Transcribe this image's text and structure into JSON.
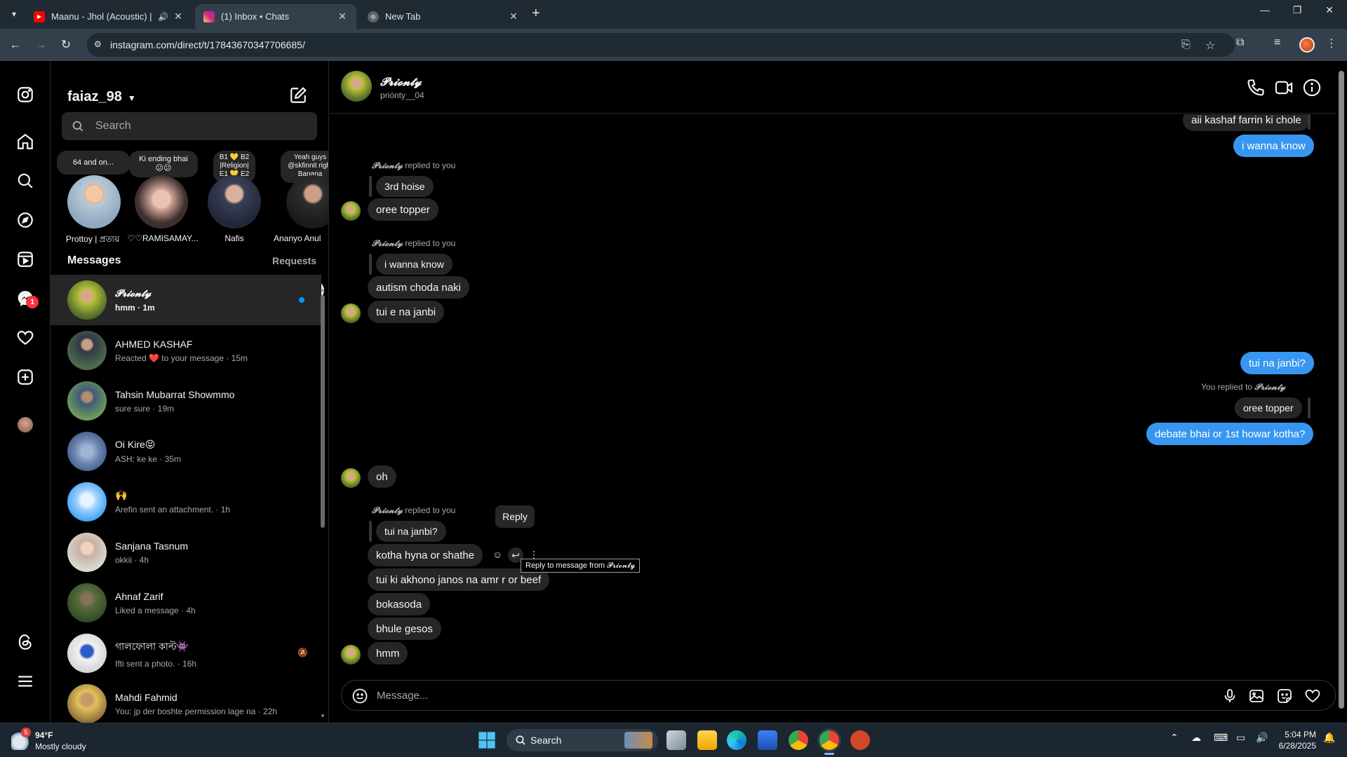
{
  "browser": {
    "tabs": [
      {
        "title": "Maanu - Jhol (Acoustic) | An",
        "favicon": "youtube-icon",
        "audio": true
      },
      {
        "title": "(1) Inbox • Chats",
        "favicon": "instagram-icon",
        "active": true
      },
      {
        "title": "New Tab",
        "favicon": "chrome-icon"
      }
    ],
    "url": "instagram.com/direct/t/17843670347706685/"
  },
  "nav": {
    "notification_count": "1"
  },
  "inbox": {
    "username": "faiaz_98",
    "search_placeholder": "Search",
    "notes": [
      {
        "note": "64 and on...",
        "name": "Prottoy | প্রত্যয়"
      },
      {
        "note": "Ki ending bhai 😕😕",
        "name": "♡♡RAMISAMAY..."
      },
      {
        "note": "B1 💛 B2 |Religion| E1 💛 E2",
        "name": "Nafis"
      },
      {
        "note": "Yeah guys @skfinnit right Banana",
        "name": "Ananyo Anul"
      }
    ],
    "messages_label": "Messages",
    "requests_label": "Requests",
    "conversations": [
      {
        "name": "𝓟𝓻𝓲𝓸𝓷𝓽𝔂",
        "preview": "hmm · 1m",
        "unread": true,
        "selected": true
      },
      {
        "name": "AHMED KASHAF",
        "preview": "Reacted ❤️ to your message · 15m"
      },
      {
        "name": "Tahsin Mubarrat Showmmo",
        "preview": "sure sure · 19m"
      },
      {
        "name": "Oi Kire😝",
        "preview": "ASH: ke ke · 35m"
      },
      {
        "name": "🙌",
        "preview": "Arefin sent an attachment. · 1h"
      },
      {
        "name": "Sanjana Tasnum",
        "preview": "okkii · 4h"
      },
      {
        "name": "Ahnaf Zarif",
        "preview": "Liked a message · 4h"
      },
      {
        "name": "গালফোলা কাল্ট👾",
        "preview": "Ifti sent a photo. · 16h",
        "muted": true
      },
      {
        "name": "Mahdi Fahmid",
        "preview": "You: jp der boshte permission lage na · 22h"
      }
    ]
  },
  "chat": {
    "name": "𝓟𝓻𝓲𝓸𝓷𝓽𝔂",
    "username": "priónty__04",
    "reply_label_them": "replied to you",
    "reply_label_you": "You replied to",
    "reply_label_you_name": "𝓟𝓻𝓲𝓸𝓷𝓽𝔂",
    "reply_label_them_name": "𝓟𝓻𝓲𝓸𝓷𝓽𝔂",
    "messages": {
      "m1": "aii kashaf farrin ki chole",
      "m2": "i wanna know",
      "q1": "3rd hoise",
      "m3": "oree topper",
      "q2": "i wanna know",
      "m4": "autism choda naki",
      "m5": "tui e na janbi",
      "m6": "tui na janbi?",
      "q3": "oree topper",
      "m7": "debate bhai or 1st howar kotha?",
      "m8": "oh",
      "q4": "tui na janbi?",
      "m9": "kotha hyna   or shathe",
      "m10": "tui ki akhono janos na amr r or beef",
      "m11": "bokasoda",
      "m12": "bhule gesos",
      "m13": "hmm"
    },
    "tooltip_reply": "Reply",
    "tooltip_system": "Reply to message from 𝓟𝓻𝓲𝓸𝓷𝓽𝔂",
    "composer_placeholder": "Message..."
  },
  "taskbar": {
    "weather_temp": "94°F",
    "weather_cond": "Mostly cloudy",
    "weather_badge": "5",
    "search_label": "Search",
    "time": "5:04 PM",
    "date": "6/28/2025"
  },
  "colors": {
    "accent_blue": "#3797f0",
    "incoming_bubble": "#262626",
    "unread_dot": "#0095f6",
    "badge_red": "#ff3040"
  }
}
